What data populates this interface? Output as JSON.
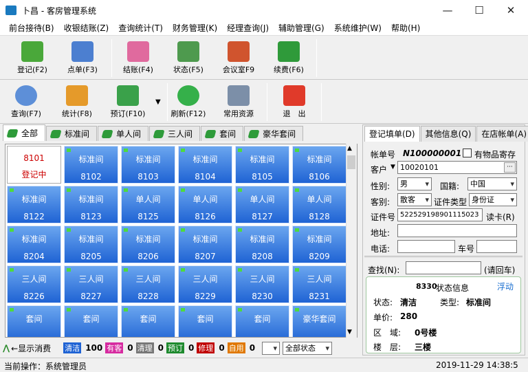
{
  "window": {
    "title": "卜昌 - 客房管理系统",
    "minimize": "—",
    "maximize": "☐",
    "close": "✕",
    "accent": "#1f63d4"
  },
  "menu": [
    "前台接待(B)",
    "收银结账(Z)",
    "查询统计(T)",
    "财务管理(K)",
    "经理查询(J)",
    "辅助管理(G)",
    "系统维护(W)",
    "帮助(H)"
  ],
  "toolbar1": [
    {
      "label": "登记(F2)",
      "icon": "checkin-icon"
    },
    {
      "label": "点单(F3)",
      "icon": "order-icon"
    },
    {
      "label": "结账(F4)",
      "icon": "checkout-icon"
    },
    {
      "label": "状态(F5)",
      "icon": "status-icon"
    },
    {
      "label": "会议室F9",
      "icon": "meeting-room-icon"
    },
    {
      "label": "续费(F6)",
      "icon": "renew-icon"
    }
  ],
  "toolbar2": [
    {
      "label": "查询(F7)",
      "icon": "search-icon"
    },
    {
      "label": "统计(F8)",
      "icon": "stats-icon"
    },
    {
      "label": "预订(F10)",
      "icon": "reserve-icon"
    },
    {
      "label": "刷新(F12)",
      "icon": "refresh-icon"
    },
    {
      "label": "常用资源",
      "icon": "resources-icon"
    },
    {
      "label": "退　出",
      "icon": "exit-icon"
    }
  ],
  "tabs": [
    "全部",
    "标准间",
    "单人间",
    "三人间",
    "套间",
    "豪华套间"
  ],
  "rooms": [
    {
      "type": "8101",
      "num": "登记中",
      "state": "occupied"
    },
    {
      "type": "标准间",
      "num": "8102"
    },
    {
      "type": "标准间",
      "num": "8103"
    },
    {
      "type": "标准间",
      "num": "8104"
    },
    {
      "type": "标准间",
      "num": "8105"
    },
    {
      "type": "标准间",
      "num": "8106"
    },
    {
      "type": "标准间",
      "num": "8122"
    },
    {
      "type": "标准间",
      "num": "8123"
    },
    {
      "type": "单人间",
      "num": "8125"
    },
    {
      "type": "单人间",
      "num": "8126"
    },
    {
      "type": "单人间",
      "num": "8127"
    },
    {
      "type": "单人间",
      "num": "8128"
    },
    {
      "type": "标准间",
      "num": "8204"
    },
    {
      "type": "标准间",
      "num": "8205"
    },
    {
      "type": "标准间",
      "num": "8206"
    },
    {
      "type": "标准间",
      "num": "8207"
    },
    {
      "type": "标准间",
      "num": "8208"
    },
    {
      "type": "标准间",
      "num": "8209"
    },
    {
      "type": "三人间",
      "num": "8226"
    },
    {
      "type": "三人间",
      "num": "8227"
    },
    {
      "type": "三人间",
      "num": "8228"
    },
    {
      "type": "三人间",
      "num": "8229"
    },
    {
      "type": "三人间",
      "num": "8230"
    },
    {
      "type": "三人间",
      "num": "8231"
    },
    {
      "type": "套间",
      "num": ""
    },
    {
      "type": "套间",
      "num": ""
    },
    {
      "type": "套间",
      "num": ""
    },
    {
      "type": "套间",
      "num": ""
    },
    {
      "type": "套间",
      "num": ""
    },
    {
      "type": "豪华套间",
      "num": ""
    }
  ],
  "status_strip": {
    "show_consume": "←显示消费",
    "legend": [
      {
        "label": "清洁",
        "count": "100",
        "color": "#1f63d4"
      },
      {
        "label": "有客",
        "count": "0",
        "color": "#d62ba0"
      },
      {
        "label": "清理",
        "count": "0",
        "color": "#777777"
      },
      {
        "label": "预订",
        "count": "0",
        "color": "#1e8a2e"
      },
      {
        "label": "修理",
        "count": "0",
        "color": "#c00000"
      },
      {
        "label": "自用",
        "count": "0",
        "color": "#e07800"
      }
    ],
    "filter": "全部状态"
  },
  "right_tabs": [
    "登记填单(D)",
    "其他信息(Q)",
    "在店帐单(A)"
  ],
  "form": {
    "account_label": "帐单号",
    "account_value": "N100000001",
    "deposit_label": "有物品寄存",
    "customer_label": "客户",
    "customer_value": "10020101",
    "gender_label": "性别:",
    "gender_value": "男",
    "nation_label": "国籍:",
    "nation_value": "中国",
    "guesttype_label": "客别:",
    "guesttype_value": "散客",
    "idtype_label": "证件类型",
    "idtype_value": "身份证",
    "idno_label": "证件号",
    "idno_value": "522529198901115023",
    "readcard_label": "读卡(R)",
    "address_label": "地址:",
    "phone_label": "电话:",
    "plate_label": "车号"
  },
  "search": {
    "label": "查找(N):",
    "hint": "(请回车)"
  },
  "info": {
    "room": "8330",
    "title_suffix": "状态信息",
    "float": "浮动",
    "status_label": "状态:",
    "status_value": "清洁",
    "type_label": "类型:",
    "type_value": "标准间",
    "price_label": "单价:",
    "price_value": "280",
    "area_label": "区　域:",
    "area_value": "0号楼",
    "floor_label": "楼　层:",
    "floor_value": "三楼"
  },
  "footer": {
    "operation": "当前操作：系统管理员",
    "datetime": "2019-11-29 14:38:5"
  }
}
